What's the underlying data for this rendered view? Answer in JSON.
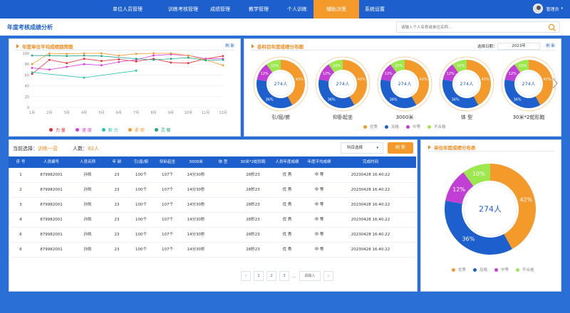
{
  "nav": [
    {
      "label": "单位人员管理",
      "active": false
    },
    {
      "label": "训练考核管理",
      "active": false
    },
    {
      "label": "成绩管理",
      "active": false
    },
    {
      "label": "教学管理",
      "active": false
    },
    {
      "label": "个人训练",
      "active": false
    },
    {
      "label": "辅助决策",
      "active": true
    },
    {
      "label": "系统设置",
      "active": false
    }
  ],
  "user": {
    "name": "管理员",
    "caret": "▾"
  },
  "page_title": "年度考核成绩分析",
  "search": {
    "placeholder": "请输入个人名称或单位名称..."
  },
  "colors": {
    "primary": "#1d5fcc",
    "accent": "#f39a2b",
    "excellent": "#f39a2b",
    "good": "#1d5fcc",
    "medium": "#c23fd6",
    "fail": "#9ee84f"
  },
  "trend_panel": {
    "title": "年度单位平均成绩趋势图",
    "refresh": "刷 新"
  },
  "subjects_panel": {
    "title": "各科目年度成绩分布图",
    "refresh": "刷 新",
    "date_label": "选择日期：",
    "date_value": "2023年"
  },
  "donut_legend": [
    "优秀",
    "及格",
    "中等",
    "不合格"
  ],
  "unit_panel": {
    "title": "单位年度成绩分布表"
  },
  "chart_data": [
    {
      "type": "line",
      "title": "年度单位平均成绩趋势图",
      "categories": [
        "1月",
        "2月",
        "3月",
        "4月",
        "5月",
        "6月",
        "7月",
        "8月",
        "9月",
        "10月",
        "11月",
        "12月"
      ],
      "yticks": [
        0,
        20,
        40,
        60,
        80,
        100
      ],
      "ylim": [
        0,
        100
      ],
      "grid": true,
      "legend_position": "bottom",
      "series": [
        {
          "name": "力 量",
          "color": "#e02d2d",
          "values": [
            62,
            88,
            82,
            90,
            86,
            89,
            85,
            90,
            83,
            82,
            90,
            95
          ]
        },
        {
          "name": "速 度",
          "color": "#d93ad9",
          "values": [
            73,
            70,
            75,
            80,
            78,
            84,
            88,
            96,
            98,
            96,
            90,
            90
          ]
        },
        {
          "name": "耐 力",
          "color": "#26c2b2",
          "values": [
            65,
            null,
            null,
            55,
            null,
            null,
            68,
            null,
            null,
            null,
            null,
            null
          ]
        },
        {
          "name": "柔 韧",
          "color": "#f39a2b",
          "values": [
            80,
            100,
            99,
            100,
            100,
            96,
            99,
            100,
            100,
            96,
            88,
            78
          ]
        },
        {
          "name": "灵 敏",
          "color": "#22a38a",
          "values": [
            96,
            96,
            95,
            96,
            95,
            null,
            90,
            88,
            90,
            92,
            87,
            88
          ]
        }
      ]
    },
    {
      "type": "pie",
      "donut": true,
      "title": "引/屈/俯",
      "center": "274人",
      "labels": [
        "优秀",
        "及格",
        "中等",
        "不合格"
      ],
      "values": [
        42,
        36,
        12,
        10
      ]
    },
    {
      "type": "pie",
      "donut": true,
      "title": "仰卧起坐",
      "center": "274人",
      "labels": [
        "优秀",
        "及格",
        "中等",
        "不合格"
      ],
      "values": [
        42,
        36,
        12,
        10
      ]
    },
    {
      "type": "pie",
      "donut": true,
      "title": "3000米",
      "center": "274人",
      "labels": [
        "优秀",
        "及格",
        "中等",
        "不合格"
      ],
      "values": [
        42,
        36,
        12,
        10
      ]
    },
    {
      "type": "pie",
      "donut": true,
      "title": "体 型",
      "center": "274人",
      "labels": [
        "优秀",
        "及格",
        "中等",
        "不合格"
      ],
      "values": [
        42,
        36,
        12,
        10
      ]
    },
    {
      "type": "pie",
      "donut": true,
      "title": "30米*2蛇形跑",
      "center": "274人",
      "labels": [
        "优秀",
        "及格",
        "中等",
        "不合格"
      ],
      "values": [
        42,
        36,
        12,
        10
      ]
    },
    {
      "type": "pie",
      "donut": true,
      "title": "单位年度成绩分布表",
      "center": "274人",
      "labels": [
        "优秀",
        "及格",
        "中等",
        "不合格"
      ],
      "values": [
        42,
        36,
        12,
        10
      ]
    }
  ],
  "table": {
    "current_label": "当前选择：",
    "current_value": "训练一营",
    "count_label": "人数：",
    "count_value": "82人",
    "subject_select": "科目选择",
    "subject_caret": "▾",
    "refresh_btn": "刷 新",
    "headers": [
      "序 号",
      "人员编号",
      "人员名称",
      "年 龄",
      "引/屈/俯",
      "仰卧起坐",
      "3000米",
      "体 型",
      "30米*2蛇形跑",
      "人员年度成绩",
      "年度平均成绩",
      "完成时间"
    ],
    "rows": [
      [
        "1",
        "879982001",
        "孙凯",
        "23",
        "100个",
        "107个",
        "14分30秒",
        "",
        "28秒23",
        "优 秀",
        "中 等",
        "20230428 16:40:22"
      ],
      [
        "2",
        "879982001",
        "孙凯",
        "23",
        "100个",
        "107个",
        "14分30秒",
        "",
        "28秒23",
        "优 秀",
        "中 等",
        "20230428 16:40:22"
      ],
      [
        "3",
        "879982001",
        "孙凯",
        "23",
        "100个",
        "107个",
        "14分30秒",
        "",
        "28秒23",
        "优 秀",
        "中 等",
        "20230428 16:40:22"
      ],
      [
        "4",
        "879982001",
        "孙凯",
        "23",
        "100个",
        "107个",
        "14分30秒",
        "",
        "28秒23",
        "优 秀",
        "中 等",
        "20230428 16:40:22"
      ],
      [
        "6",
        "879982001",
        "孙凯",
        "23",
        "100个",
        "107个",
        "14分30秒",
        "",
        "28秒23",
        "优 秀",
        "中 等",
        "20230428 16:40:22"
      ],
      [
        "6",
        "879982001",
        "孙凯",
        "23",
        "100个",
        "107个",
        "14分30秒",
        "",
        "28秒23",
        "优 秀",
        "中 等",
        "20230428 16:40:22"
      ]
    ]
  },
  "pager": {
    "prev": "‹",
    "pages": [
      "1",
      "2",
      "3"
    ],
    "ellipsis": "...",
    "jump_placeholder": "请输入",
    "next": "›"
  }
}
